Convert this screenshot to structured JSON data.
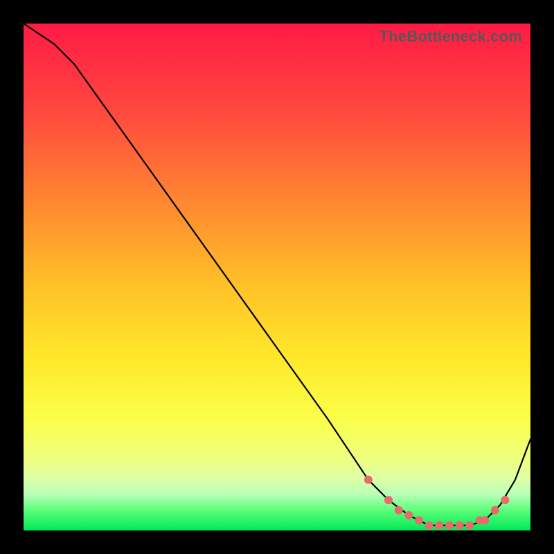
{
  "watermark": "TheBottleneck.com",
  "chart_data": {
    "type": "line",
    "title": "",
    "xlabel": "",
    "ylabel": "",
    "xlim": [
      0,
      100
    ],
    "ylim": [
      0,
      100
    ],
    "series": [
      {
        "name": "curve",
        "x": [
          0,
          6,
          10,
          20,
          30,
          40,
          50,
          60,
          68,
          72,
          76,
          80,
          84,
          88,
          91,
          94,
          97,
          100
        ],
        "values": [
          100,
          96,
          92,
          78,
          64,
          50,
          36,
          22,
          10,
          6,
          3,
          1,
          1,
          1,
          2,
          5,
          10,
          18
        ]
      }
    ],
    "markers": {
      "name": "valley-dots",
      "color": "#e86a6a",
      "x": [
        68,
        72,
        74,
        76,
        78,
        80,
        82,
        84,
        86,
        88,
        90,
        91,
        93,
        95
      ],
      "values": [
        10,
        6,
        4,
        3,
        2,
        1,
        1,
        1,
        1,
        1,
        2,
        2,
        4,
        6
      ]
    }
  }
}
